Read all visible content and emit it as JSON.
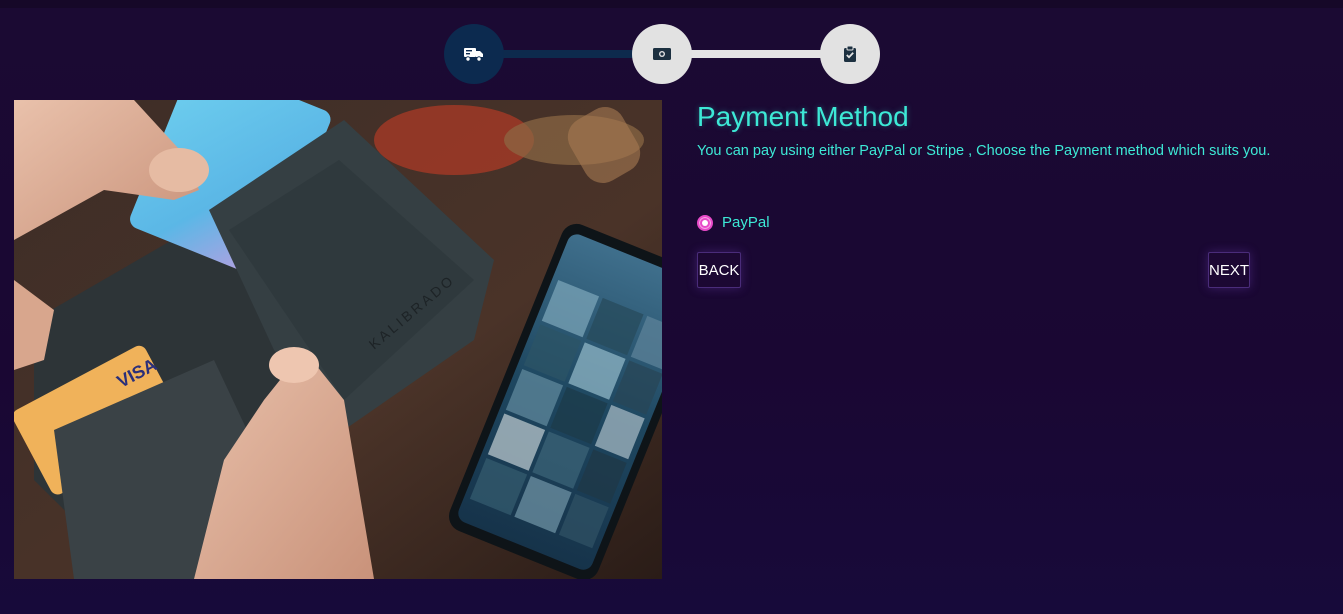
{
  "stepper": {
    "steps": [
      {
        "icon": "truck-icon",
        "state": "active"
      },
      {
        "icon": "money-icon",
        "state": "pending"
      },
      {
        "icon": "clipboard-check-icon",
        "state": "pending"
      }
    ],
    "colors": {
      "active": "#0c2a4f",
      "pending": "#e2e2e2"
    }
  },
  "photo": {
    "subject": "hands-holding-wallet-with-cards-and-phone",
    "wallet_text": "KALIBRADO",
    "card_text": "VISA"
  },
  "payment": {
    "title": "Payment Method",
    "description": "You can pay using either PayPal or Stripe , Choose the Payment method which suits you.",
    "options": [
      {
        "label": "PayPal",
        "selected": true
      }
    ]
  },
  "actions": {
    "back_label": "BACK",
    "next_label": "NEXT"
  },
  "theme": {
    "background": "#1b0a33",
    "accent": "#3de9d6",
    "radio": "#e84ac9"
  }
}
